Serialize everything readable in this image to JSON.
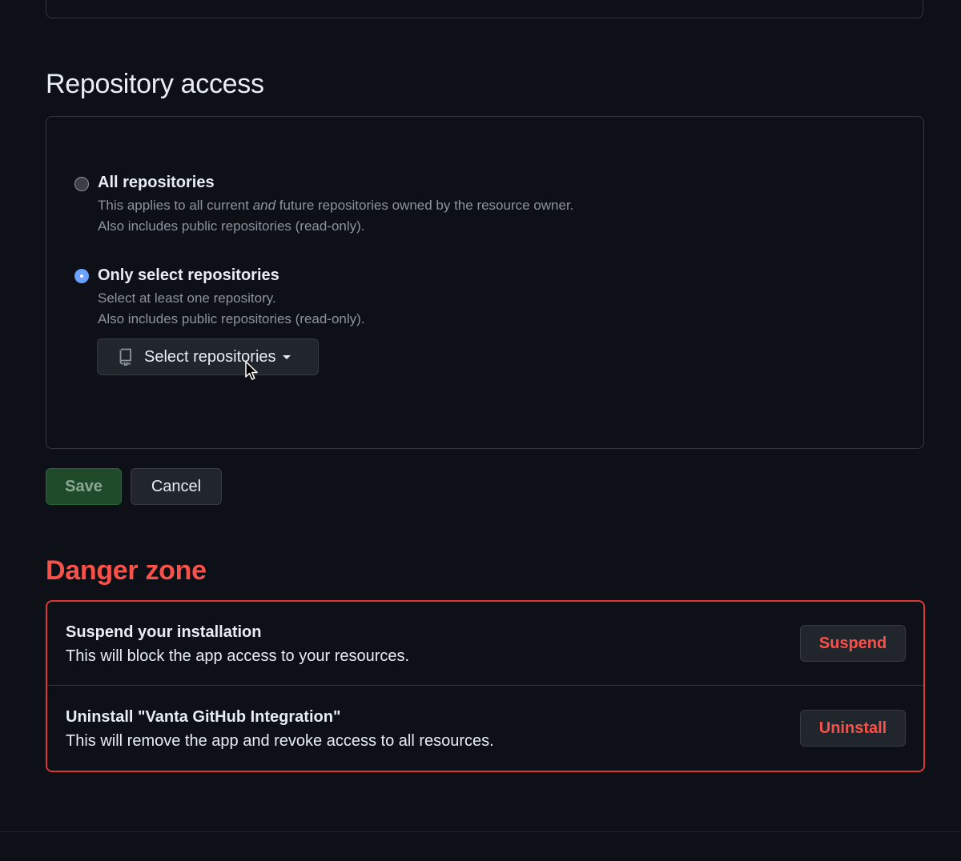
{
  "repository_access": {
    "title": "Repository access",
    "options": [
      {
        "label": "All repositories",
        "desc_line1_pre": "This applies to all current ",
        "desc_line1_em": "and",
        "desc_line1_post": " future repositories owned by the resource owner.",
        "desc_line2": "Also includes public repositories (read-only).",
        "selected": false
      },
      {
        "label": "Only select repositories",
        "desc_line1": "Select at least one repository.",
        "desc_line2": "Also includes public repositories (read-only).",
        "selected": true
      }
    ],
    "select_button_label": "Select repositories"
  },
  "actions": {
    "save_label": "Save",
    "cancel_label": "Cancel"
  },
  "danger_zone": {
    "title": "Danger zone",
    "items": [
      {
        "title": "Suspend your installation",
        "description": "This will block the app access to your resources.",
        "button_label": "Suspend"
      },
      {
        "title": "Uninstall \"Vanta GitHub Integration\"",
        "description": "This will remove the app and revoke access to all resources.",
        "button_label": "Uninstall"
      }
    ]
  },
  "colors": {
    "background": "#0d1117",
    "danger": "#f85149",
    "accent_radio": "#6aa0ff",
    "save_button": "#1f4b2a"
  }
}
